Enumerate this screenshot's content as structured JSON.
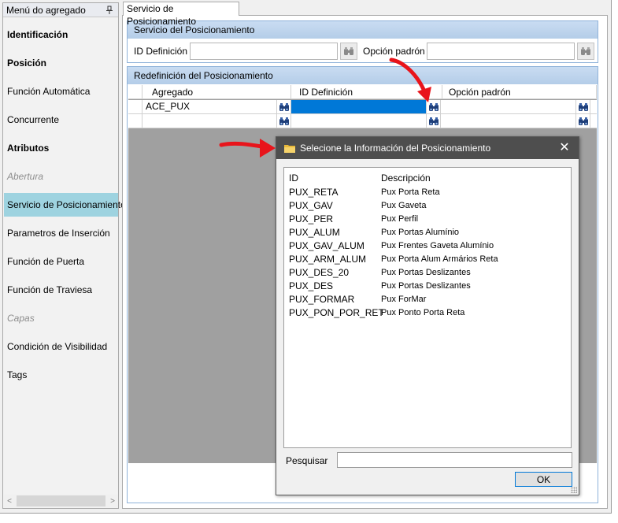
{
  "left_panel": {
    "title": "Menú do agregado",
    "items": [
      {
        "label": "Identificación",
        "style": "bold"
      },
      {
        "label": "Posición",
        "style": "bold"
      },
      {
        "label": "Función Automática",
        "style": "normal"
      },
      {
        "label": "Concurrente",
        "style": "normal"
      },
      {
        "label": "Atributos",
        "style": "bold"
      },
      {
        "label": "Abertura",
        "style": "disabled"
      },
      {
        "label": "Servicio de Posicionamiento",
        "style": "active"
      },
      {
        "label": "Parametros de Inserción",
        "style": "normal"
      },
      {
        "label": "Función de Puerta",
        "style": "normal"
      },
      {
        "label": "Función de Traviesa",
        "style": "normal"
      },
      {
        "label": "Capas",
        "style": "disabled"
      },
      {
        "label": "Condición de Visibilidad",
        "style": "normal"
      },
      {
        "label": "Tags",
        "style": "normal"
      }
    ],
    "scroll_left": "<",
    "scroll_right": ">"
  },
  "tab": {
    "label": "Servicio de Posicionamiento"
  },
  "section1": {
    "title": "Servicio del Posicionamiento",
    "id_label": "ID Definición",
    "id_value": "",
    "default_label": "Opción padrón",
    "default_value": ""
  },
  "section2": {
    "title": "Redefinición del Posicionamiento",
    "columns": [
      "Agregado",
      "ID Definición",
      "Opción padrón"
    ],
    "rows": [
      {
        "agregado": "ACE_PUX",
        "id": "",
        "default": ""
      },
      {
        "agregado": "",
        "id": "",
        "default": ""
      }
    ]
  },
  "dialog": {
    "title": "Selecione la Información del Posicionamiento",
    "close": "✕",
    "columns": [
      "ID",
      "Descripción"
    ],
    "items": [
      {
        "id": "PUX_RETA",
        "desc": "Pux Porta Reta"
      },
      {
        "id": "PUX_GAV",
        "desc": "Pux Gaveta"
      },
      {
        "id": "PUX_PER",
        "desc": "Pux Perfil"
      },
      {
        "id": "PUX_ALUM",
        "desc": "Pux Portas Alumínio"
      },
      {
        "id": "PUX_GAV_ALUM",
        "desc": "Pux Frentes Gaveta Alumínio"
      },
      {
        "id": "PUX_ARM_ALUM",
        "desc": "Pux Porta Alum Armários Reta"
      },
      {
        "id": "PUX_DES_20",
        "desc": "Pux Portas Deslizantes"
      },
      {
        "id": "PUX_DES",
        "desc": "Pux Portas Deslizantes"
      },
      {
        "id": "PUX_FORMAR",
        "desc": "Pux ForMar"
      },
      {
        "id": "PUX_PON_POR_RET",
        "desc": "Pux Ponto Porta Reta"
      }
    ],
    "search_label": "Pesquisar",
    "search_value": "",
    "ok_label": "OK"
  },
  "colors": {
    "accent": "#0078d7",
    "active_menu": "#9ed3e0",
    "section_header": "#c1d6ee",
    "annotation_arrow": "#e8141b"
  },
  "icons": [
    "pin-icon",
    "binoculars-icon",
    "folder-icon",
    "close-icon",
    "arrow-annotation"
  ]
}
